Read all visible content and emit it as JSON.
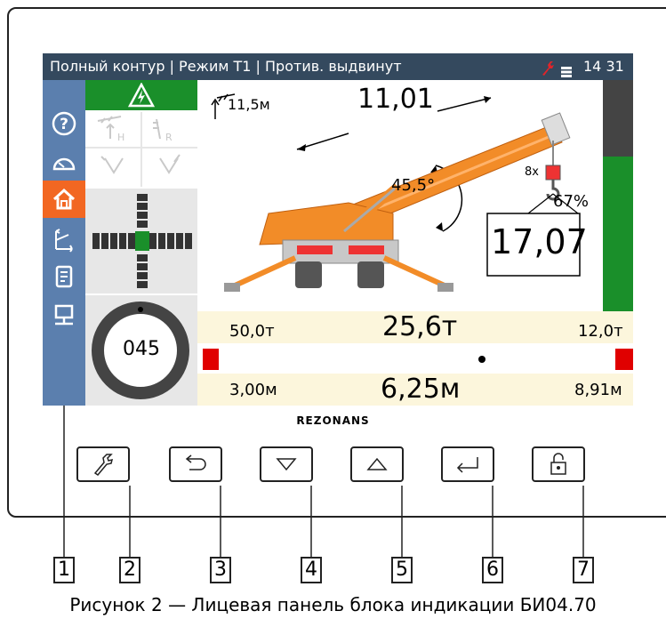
{
  "status_bar": {
    "text": "Полный контур | Режим Т1 | Против. выдвинут",
    "time": "14 31",
    "colors": {
      "bg": "#34495e",
      "wrench_icon": "#e0242a"
    }
  },
  "sidebar": {
    "items": [
      {
        "icon": "help-icon"
      },
      {
        "icon": "gauge-icon"
      },
      {
        "icon": "home-icon",
        "active": true
      },
      {
        "icon": "crane-boom-icon"
      },
      {
        "icon": "document-icon"
      },
      {
        "icon": "monitor-icon"
      }
    ],
    "colors": {
      "bg": "#5b7fae",
      "active": "#f26722"
    }
  },
  "left_panel": {
    "warning_icon": "electric-hazard-icon",
    "compass_value": "045"
  },
  "crane_view": {
    "height_label": "11,5м",
    "boom_length": "11,01",
    "angle": "45,5°",
    "reeving": "8x",
    "load_percent": "67%",
    "load_value": "17,07",
    "load_percent_level": 0.67,
    "colors": {
      "crane": "#f28c28",
      "green": "#1a8f2a",
      "gray": "#444444"
    }
  },
  "bottom_band": {
    "left_load": "50,0т",
    "current_load": "25,6т",
    "right_load": "12,0т",
    "left_radius": "3,00м",
    "current_radius": "6,25м",
    "right_radius": "8,91м",
    "colors": {
      "band": "#fcf6dc",
      "limit": "#e00000"
    }
  },
  "brand": "REZONANS",
  "keys": [
    {
      "icon": "wrench-icon"
    },
    {
      "icon": "back-arrow-icon"
    },
    {
      "icon": "down-triangle-icon"
    },
    {
      "icon": "up-triangle-icon"
    },
    {
      "icon": "enter-icon"
    },
    {
      "icon": "unlock-icon"
    }
  ],
  "callouts": [
    "1",
    "2",
    "3",
    "4",
    "5",
    "6",
    "7"
  ],
  "caption": "Рисунок 2 — Лицевая панель блока индикации БИ04.70"
}
